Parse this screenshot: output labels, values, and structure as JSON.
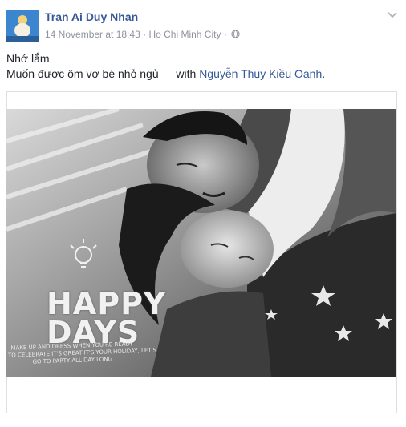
{
  "post": {
    "author": "Tran Ai Duy Nhan",
    "date": "14 November at 18:43",
    "separator": "·",
    "location": "Ho Chi Minh City",
    "audience_icon": "globe-icon",
    "menu_icon": "chevron-down-icon",
    "line1": "Nhớ lắm",
    "line2_prefix": "Muốn được ôm vợ bé nhỏ ngủ — with ",
    "tagged_person": "Nguyễn Thụy Kiều Oanh",
    "line2_suffix": "."
  },
  "photo_overlay": {
    "line1": "HAPPY",
    "line2": "DAYS",
    "caption1": "MAKE UP AND DRESS WHEN YOU'RE READY",
    "caption2": "TO CELEBRATE IT'S GREAT IT'S YOUR HOLIDAY, LET'S",
    "caption3": "GO TO PARTY ALL DAY LONG"
  },
  "colors": {
    "link": "#365899",
    "meta": "#90949c",
    "text": "#1d2129",
    "border": "#dddfe2"
  }
}
